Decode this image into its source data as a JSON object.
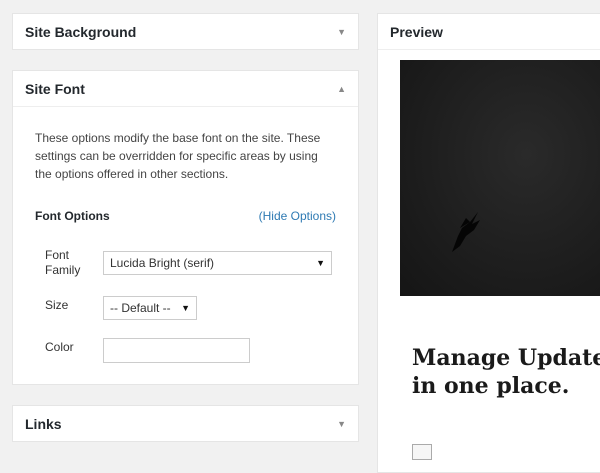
{
  "panels": {
    "site_background": {
      "title": "Site Background",
      "caret": "▼"
    },
    "site_font": {
      "title": "Site Font",
      "caret": "▲",
      "description": "These options modify the base font on the site. These settings can be overridden for specific areas by using the options offered in other sections.",
      "font_options_label": "Font Options",
      "hide_options_link": "(Hide Options)",
      "font_family": {
        "label_line1": "Font",
        "label_line2": "Family",
        "value": "Lucida Bright (serif)"
      },
      "size": {
        "label": "Size",
        "value": "-- Default --"
      },
      "color": {
        "label": "Color",
        "value": ""
      }
    },
    "links": {
      "title": "Links",
      "caret": "▼"
    }
  },
  "preview": {
    "title": "Preview",
    "headline_line1": "Manage Updates",
    "headline_line2": "in one place."
  },
  "icons": {
    "dropdown": "▼"
  }
}
